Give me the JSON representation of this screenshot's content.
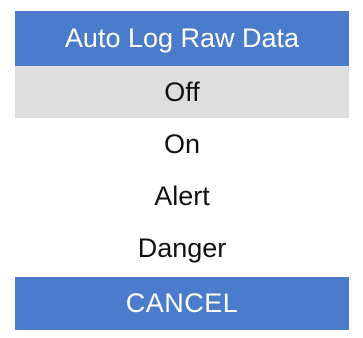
{
  "dialog": {
    "title": "Auto Log Raw Data",
    "options": [
      {
        "label": "Off",
        "selected": true
      },
      {
        "label": "On",
        "selected": false
      },
      {
        "label": "Alert",
        "selected": false
      },
      {
        "label": "Danger",
        "selected": false
      }
    ],
    "cancel_label": "CANCEL"
  },
  "colors": {
    "accent": "#4a7ccb",
    "selected_row": "#dedede",
    "background": "#ffffff",
    "text": "#111111"
  }
}
